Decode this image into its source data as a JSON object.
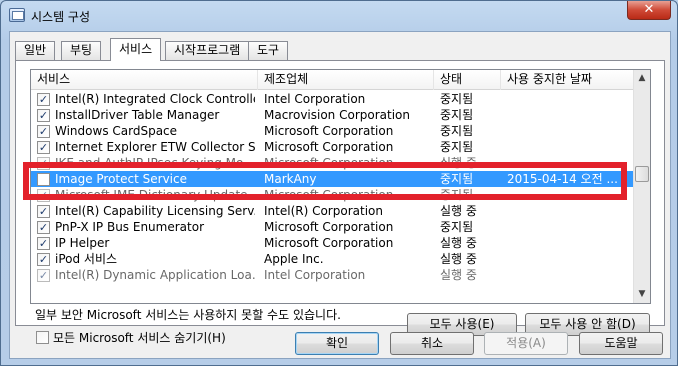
{
  "window": {
    "title": "시스템 구성",
    "close_glyph": "✕"
  },
  "tabs": [
    {
      "label": "일반"
    },
    {
      "label": "부팅"
    },
    {
      "label": "서비스"
    },
    {
      "label": "시작프로그램"
    },
    {
      "label": "도구"
    }
  ],
  "services": {
    "columns": [
      "서비스",
      "제조업체",
      "상태",
      "사용 중지한 날짜"
    ],
    "rows": [
      {
        "checked": true,
        "name": "Intel(R) Integrated Clock Controlle...",
        "vendor": "Intel Corporation",
        "status": "중지됨",
        "date": ""
      },
      {
        "checked": true,
        "name": "InstallDriver Table Manager",
        "vendor": "Macrovision Corporation",
        "status": "중지됨",
        "date": ""
      },
      {
        "checked": true,
        "name": "Windows CardSpace",
        "vendor": "Microsoft Corporation",
        "status": "중지됨",
        "date": ""
      },
      {
        "checked": true,
        "name": "Internet Explorer ETW Collector S...",
        "vendor": "Microsoft Corporation",
        "status": "중지됨",
        "date": ""
      },
      {
        "checked": true,
        "name": "IKE and AuthIP IPsec Keying Mo...",
        "vendor": "Microsoft Corporation",
        "status": "실행 중",
        "date": ""
      },
      {
        "checked": false,
        "name": "Image Protect Service",
        "vendor": "MarkAny",
        "status": "중지됨",
        "date": "2015-04-14 오전 ..."
      },
      {
        "checked": true,
        "name": "Microsoft IME Dictionary Update",
        "vendor": "Microsoft Corporation",
        "status": "중지됨",
        "date": ""
      },
      {
        "checked": true,
        "name": "Intel(R) Capability Licensing Serv...",
        "vendor": "Intel(R) Corporation",
        "status": "실행 중",
        "date": ""
      },
      {
        "checked": true,
        "name": "PnP-X IP Bus Enumerator",
        "vendor": "Microsoft Corporation",
        "status": "중지됨",
        "date": ""
      },
      {
        "checked": true,
        "name": "IP Helper",
        "vendor": "Microsoft Corporation",
        "status": "실행 중",
        "date": ""
      },
      {
        "checked": true,
        "name": "iPod 서비스",
        "vendor": "Apple Inc.",
        "status": "실행 중",
        "date": ""
      },
      {
        "checked": true,
        "name": "Intel(R) Dynamic Application Loa...",
        "vendor": "Intel Corporation",
        "status": "실행 중",
        "date": ""
      }
    ],
    "selected_index": 5
  },
  "note": "일부 보안 Microsoft 서비스는 사용하지 못할 수도 있습니다.",
  "buttons": {
    "enable_all": "모두 사용(E)",
    "disable_all": "모두 사용 안 함(D)",
    "ok": "확인",
    "cancel": "취소",
    "apply": "적용(A)",
    "help": "도움말"
  },
  "hide_ms": {
    "label": "모든 Microsoft 서비스 숨기기(H)",
    "checked": false
  },
  "colors": {
    "selection": "#3399ff",
    "highlight_box": "#e3212b"
  }
}
